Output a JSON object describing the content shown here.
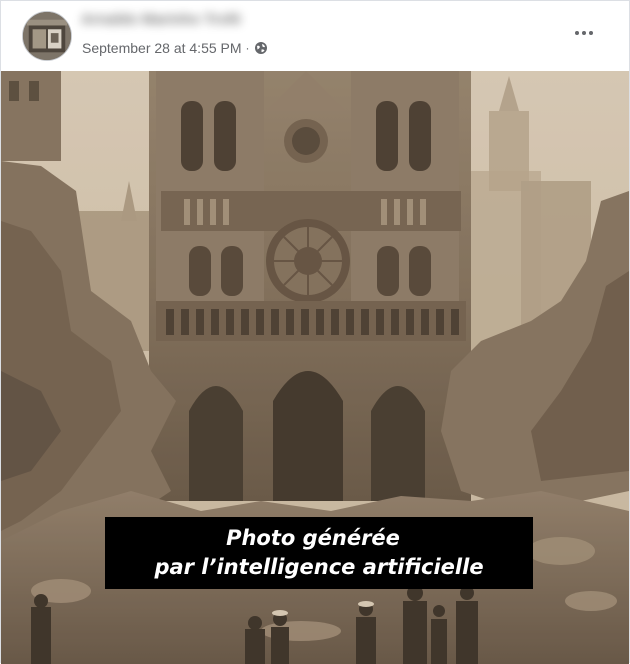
{
  "post": {
    "author": "Arnaldo Marinho Trofé",
    "timestamp": "September 28 at 4:55 PM",
    "separator": "·",
    "audience_icon": "globe-icon",
    "more_icon": "more-options-icon"
  },
  "image": {
    "caption_line1": "Photo générée",
    "caption_line2": "par l’intelligence artificielle"
  },
  "colors": {
    "sepia_light": "#d8cab4",
    "sepia_mid": "#a8957a",
    "sepia_dark": "#5a4a38",
    "caption_bg": "#000000",
    "caption_text": "#ffffff",
    "meta_text": "#65676b"
  }
}
